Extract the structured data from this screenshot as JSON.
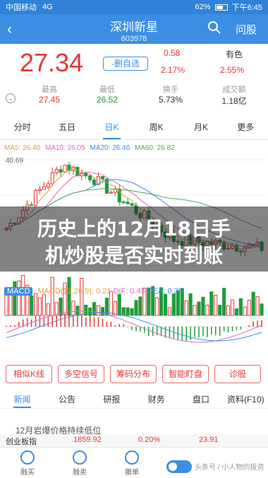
{
  "status": {
    "carrier": "中国移动",
    "network": "4G",
    "battery": "62%",
    "time": "下午6:45"
  },
  "titlebar": {
    "name": "深圳新星",
    "code": "603978",
    "ask": "问股"
  },
  "quote": {
    "price": "27.34",
    "delete_label": "-删自选",
    "change": "0.58",
    "change_pct": "2.17%",
    "color_label": "有色",
    "color_pct": "2.55%",
    "stats": [
      {
        "label": "最高",
        "value": "27.45"
      },
      {
        "label": "最低",
        "value": "26.52"
      },
      {
        "label": "换手",
        "value": "5.73%"
      },
      {
        "label": "成交额",
        "value": "1.18亿"
      }
    ]
  },
  "period_tabs": [
    "分时",
    "五日",
    "日K",
    "周K",
    "月K",
    "更多"
  ],
  "period_active": 2,
  "ma": {
    "ma5": "MA5: 26.40",
    "ma10": "MA10: 26.05",
    "ma20": "MA20: 26.46",
    "ma60": "MA60: 26.82"
  },
  "chart": {
    "max_label": "40.69"
  },
  "overlay": {
    "line1": "历史上的12月18日手",
    "line2": "机炒股是否实时到账"
  },
  "macd": {
    "badge": "MACD",
    "params": "MACD(12,26,9): 0.21",
    "dif": "DIF: 0.45",
    "dea": "DEA: 0.35"
  },
  "feature_buttons": [
    "相似K线",
    "多空信号",
    "筹码分布",
    "智能盯盘",
    "诊股"
  ],
  "content_tabs": [
    "新闻",
    "公告",
    "研报",
    "财务",
    "盘口",
    "资料(F10)"
  ],
  "content_active": 0,
  "news_first": "12月岩爆价格持续低位",
  "ticker": {
    "name": "创业板指",
    "value": "1859.92",
    "change": "0.20%",
    "points": "23.91"
  },
  "bottomnav": [
    "融买",
    "融卖",
    "撤单"
  ],
  "watermark": "头条号 / 小人物的投资"
}
